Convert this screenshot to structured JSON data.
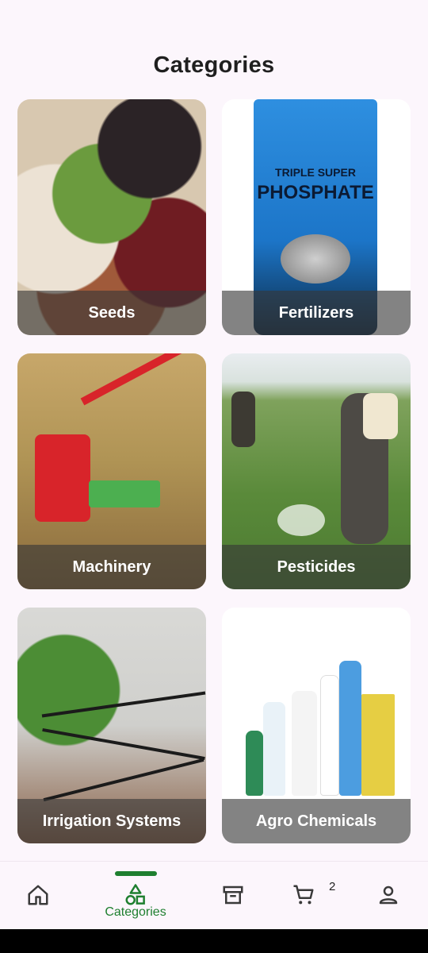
{
  "page": {
    "title": "Categories"
  },
  "categories": [
    {
      "label": "Seeds"
    },
    {
      "label": "Fertilizers"
    },
    {
      "label": "Machinery"
    },
    {
      "label": "Pesticides"
    },
    {
      "label": "Irrigation Systems"
    },
    {
      "label": "Agro Chemicals"
    }
  ],
  "fertilizer_pack": {
    "line1": "TRIPLE SUPER",
    "line2": "PHOSPHATE"
  },
  "bottom_nav": {
    "items": [
      {
        "icon": "home-icon",
        "label": ""
      },
      {
        "icon": "categories-icon",
        "label": "Categories"
      },
      {
        "icon": "archive-icon",
        "label": ""
      },
      {
        "icon": "cart-icon",
        "label": ""
      },
      {
        "icon": "profile-icon",
        "label": ""
      }
    ],
    "cart_count": "2",
    "active_color": "#1e7f2f"
  }
}
